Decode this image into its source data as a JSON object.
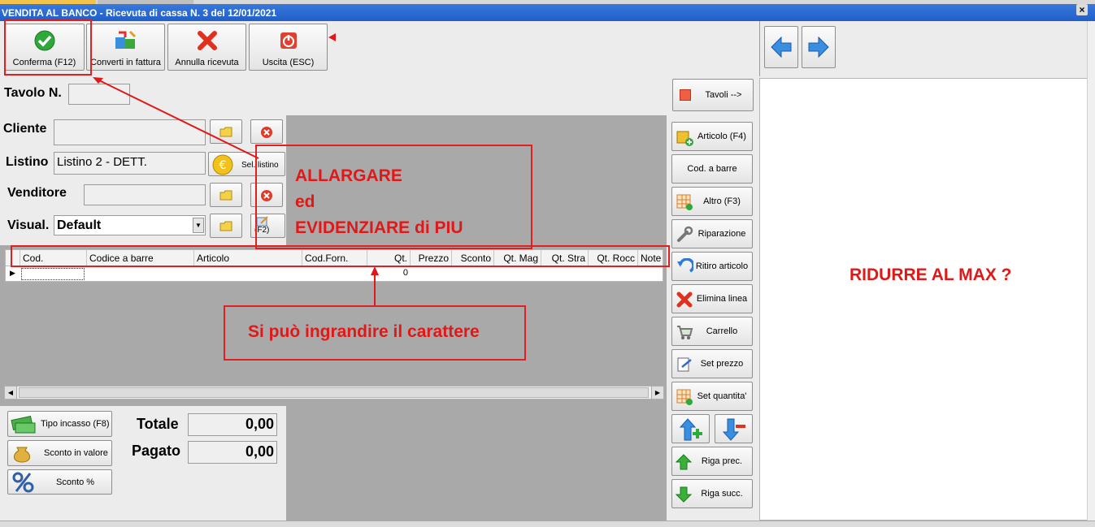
{
  "window": {
    "title": "VENDITA AL BANCO - Ricevuta di cassa N. 3 del 12/01/2021",
    "close": "×"
  },
  "toolbar": {
    "confirm": "Conferma (F12)",
    "convert": "Converti in fattura",
    "cancel": "Annulla ricevuta",
    "exit": "Uscita (ESC)"
  },
  "form": {
    "table_label": "Tavolo N.",
    "table_value": "",
    "tables_button": "Tavoli -->",
    "customer_label": "Cliente",
    "customer_value": "",
    "list_label": "Listino",
    "list_value": "Listino 2 - DETT.",
    "list_button": "Sel. listino",
    "seller_label": "Venditore",
    "seller_value": "",
    "view_label": "Visual.",
    "view_value": "Default",
    "view_btn2": "(F2)"
  },
  "grid": {
    "columns": [
      "Cod.",
      "Codice a barre",
      "Articolo",
      "Cod.Forn.",
      "Qt.",
      "Prezzo",
      "Sconto",
      "Qt. Mag",
      "Qt. Stra",
      "Qt. Rocc",
      "Note"
    ],
    "row": {
      "qty": "0"
    }
  },
  "side": {
    "article": "Articolo (F4)",
    "barcode": "Cod. a barre",
    "other": "Altro (F3)",
    "repair": "Riparazione",
    "withdraw": "Ritiro articolo",
    "delete": "Elimina linea",
    "cart": "Carrello",
    "set_price": "Set prezzo",
    "set_qty": "Set quantita'",
    "prev": "Riga prec.",
    "next": "Riga succ."
  },
  "footer": {
    "payment": "Tipo incasso (F8)",
    "discount_value": "Sconto in valore",
    "discount_pct": "Sconto %",
    "total_label": "Totale",
    "total_value": "0,00",
    "paid_label": "Pagato",
    "paid_value": "0,00"
  },
  "annotations": {
    "enlarge_1": "ALLARGARE",
    "enlarge_2": "ed",
    "enlarge_3": "EVIDENZIARE di PIU",
    "font": "Si può ingrandire il carattere",
    "reduce": "RIDURRE AL MAX ?"
  },
  "colors": {
    "title_bg": "#1f5fc8",
    "annotation_red": "#e01818"
  }
}
